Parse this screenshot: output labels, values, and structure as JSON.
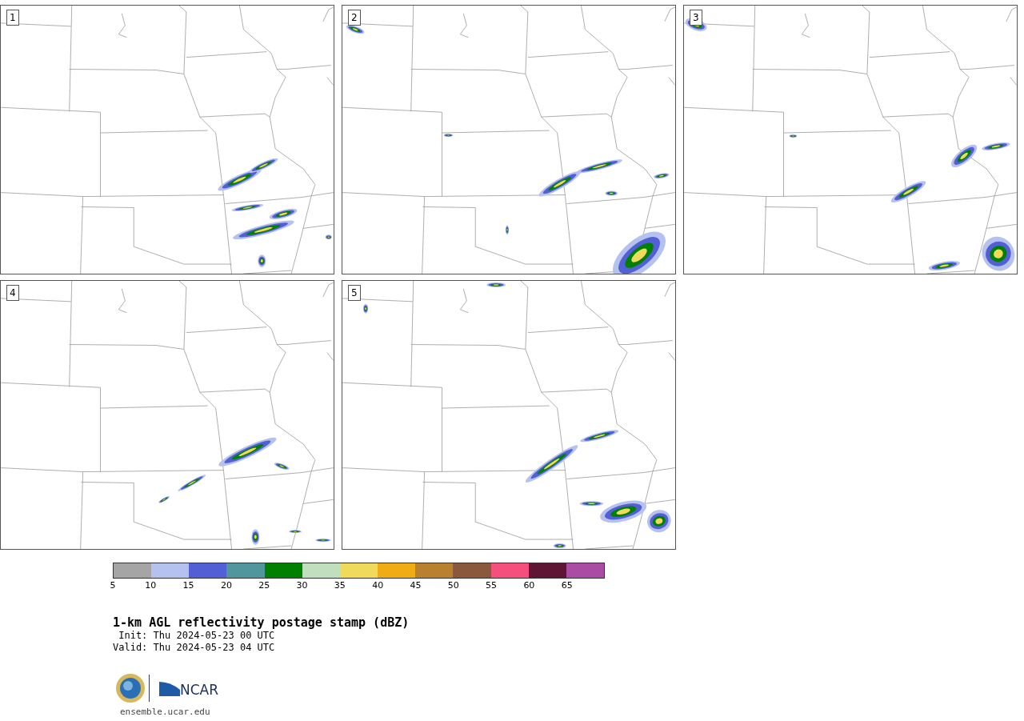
{
  "panels": [
    {
      "label": "1"
    },
    {
      "label": "2"
    },
    {
      "label": "3"
    },
    {
      "label": "4"
    },
    {
      "label": "5"
    }
  ],
  "colorbar": {
    "bins": [
      {
        "color": "#a5a5a5",
        "tick": "5"
      },
      {
        "color": "#b5c1ee",
        "tick": "10"
      },
      {
        "color": "#525fd5",
        "tick": "15"
      },
      {
        "color": "#51969c",
        "tick": "20"
      },
      {
        "color": "#008000",
        "tick": "25"
      },
      {
        "color": "#bfdfbf",
        "tick": "30"
      },
      {
        "color": "#f0da5c",
        "tick": "35"
      },
      {
        "color": "#f0ac14",
        "tick": "40"
      },
      {
        "color": "#b9802f",
        "tick": "45"
      },
      {
        "color": "#8a583d",
        "tick": "50"
      },
      {
        "color": "#f5507d",
        "tick": "55"
      },
      {
        "color": "#5e1634",
        "tick": "60"
      },
      {
        "color": "#ab4ca4",
        "tick": "65"
      }
    ]
  },
  "title": "1-km AGL reflectivity postage stamp (dBZ)",
  "init": " Init: Thu 2024-05-23 00 UTC",
  "valid": "Valid: Thu 2024-05-23 04 UTC",
  "logo_text": "NCAR",
  "url": "ensemble.ucar.edu"
}
